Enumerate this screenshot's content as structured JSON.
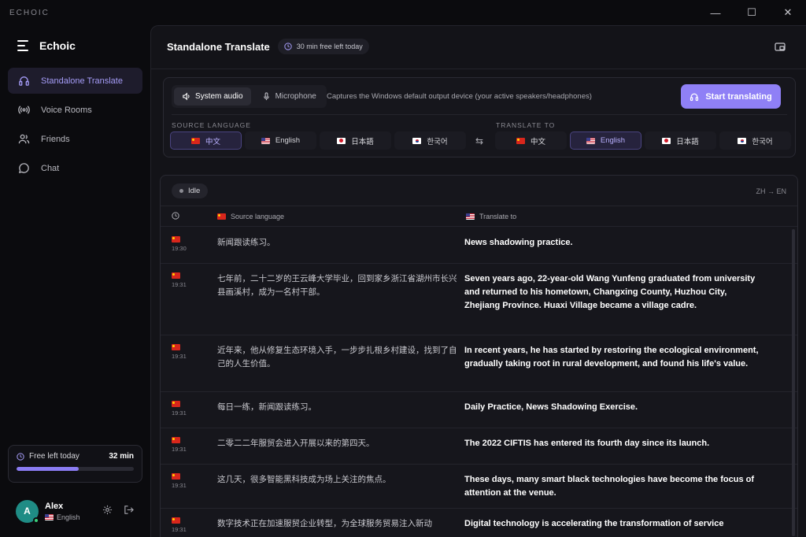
{
  "window": {
    "title": "ECHOIC",
    "controls": {
      "minimize": "—",
      "maximize": "☐",
      "close": "✕"
    }
  },
  "sidebar": {
    "brand": "Echoic",
    "items": [
      {
        "label": "Standalone Translate",
        "icon": "headphones-icon",
        "active": true
      },
      {
        "label": "Voice Rooms",
        "icon": "broadcast-icon",
        "active": false
      },
      {
        "label": "Friends",
        "icon": "users-icon",
        "active": false
      },
      {
        "label": "Chat",
        "icon": "chat-bubble-icon",
        "active": false
      }
    ],
    "free_card": {
      "label": "Free left today",
      "minutes": "32 min",
      "progress": 0.53
    },
    "user": {
      "initial": "A",
      "name": "Alex",
      "language": "English",
      "status_color": "#3bd17a"
    }
  },
  "header": {
    "title": "Standalone Translate",
    "free_pill": "30 min free left today"
  },
  "controls": {
    "sources": [
      {
        "label": "System audio",
        "icon": "speaker-icon",
        "active": true
      },
      {
        "label": "Microphone",
        "icon": "microphone-icon",
        "active": false
      }
    ],
    "hint": "Captures the Windows default output device (your active speakers/headphones)",
    "start_label": "Start translating",
    "source_language_label": "SOURCE LANGUAGE",
    "target_language_label": "TRANSLATE TO",
    "swap_glyph": "⇆",
    "source_languages": [
      {
        "label": "中文",
        "flag": "cn",
        "active": true
      },
      {
        "label": "English",
        "flag": "us",
        "active": false
      },
      {
        "label": "日本語",
        "flag": "jp",
        "active": false
      },
      {
        "label": "한국어",
        "flag": "kr",
        "active": false
      }
    ],
    "target_languages": [
      {
        "label": "中文",
        "flag": "cn",
        "active": false
      },
      {
        "label": "English",
        "flag": "us",
        "active": true
      },
      {
        "label": "日本語",
        "flag": "jp",
        "active": false
      },
      {
        "label": "한국어",
        "flag": "kr",
        "active": false
      }
    ]
  },
  "transcript": {
    "status": "Idle",
    "direction": "ZH → EN",
    "columns": {
      "source": "Source language",
      "target": "Translate to"
    },
    "rows": [
      {
        "time": "19:30",
        "source": "新闻跟读练习。",
        "target": "News shadowing practice."
      },
      {
        "time": "19:31",
        "source": "七年前，二十二岁的王云峰大学毕业，回到家乡浙江省湖州市长兴县画溪村，成为一名村干部。",
        "target": "Seven years ago, 22-year-old Wang Yunfeng graduated from university and returned to his hometown, Changxing County, Huzhou City, Zhejiang Province. Huaxi Village became a village cadre."
      },
      {
        "time": "19:31",
        "source": "近年来，他从修复生态环境入手，一步步扎根乡村建设，找到了自己的人生价值。",
        "target": "In recent years, he has started by restoring the ecological environment, gradually taking root in rural development, and found his life's value."
      },
      {
        "time": "19:31",
        "source": "每日一练，新闻跟读练习。",
        "target": "Daily Practice, News Shadowing Exercise."
      },
      {
        "time": "19:31",
        "source": "二零二二年服贸会进入开展以来的第四天。",
        "target": "The 2022 CIFTIS has entered its fourth day since its launch."
      },
      {
        "time": "19:31",
        "source": "这几天，很多智能黑科技成为场上关注的焦点。",
        "target": "These days, many smart black technologies have become the focus of attention at the venue."
      },
      {
        "time": "19:31",
        "source": "数字技术正在加速服贸企业转型，为全球服务贸易注入新动",
        "target": "Digital technology is accelerating the transformation of service"
      }
    ]
  },
  "colors": {
    "accent": "#8f80f6",
    "background": "#0b0b0e",
    "panel": "#131318"
  }
}
